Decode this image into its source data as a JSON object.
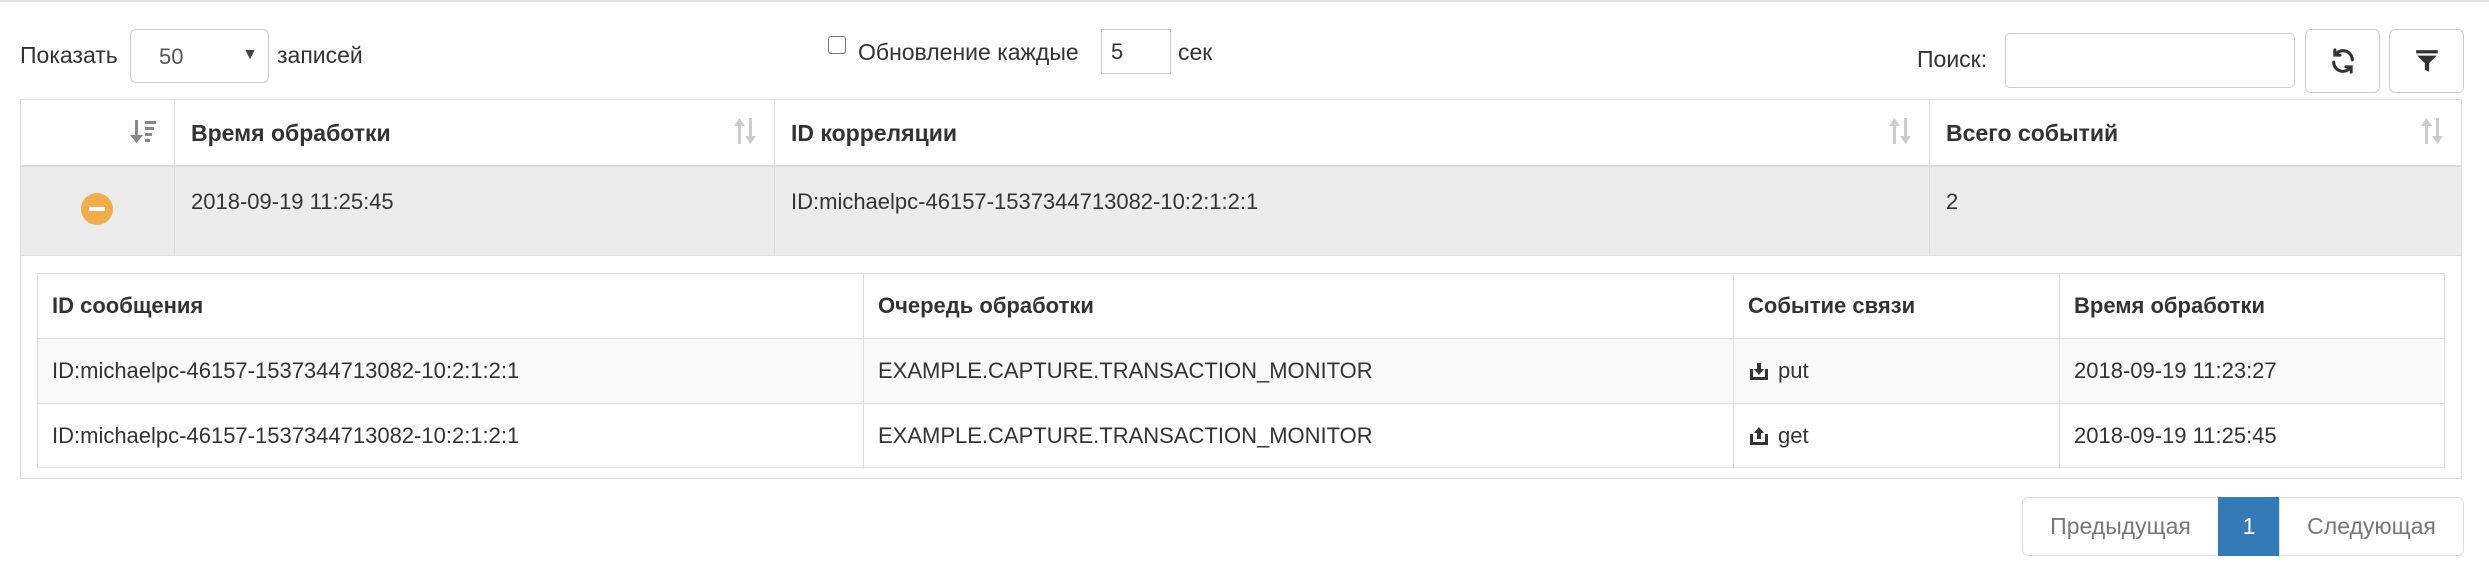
{
  "toolbar": {
    "show_label": "Показать",
    "page_size": "50",
    "records_label": "записей",
    "refresh_label": "Обновление каждые",
    "refresh_interval": "5",
    "seconds_label": "сек",
    "search_label": "Поиск:",
    "search_value": ""
  },
  "table": {
    "columns": [
      "",
      "Время обработки",
      "ID корреляции",
      "Всего событий"
    ],
    "rows": [
      {
        "time": "2018-09-19 11:25:45",
        "correlation_id": "ID:michaelpc-46157-1537344713082-10:2:1:2:1",
        "total": "2"
      }
    ]
  },
  "details": {
    "columns": [
      "ID сообщения",
      "Очередь обработки",
      "Событие связи",
      "Время обработки"
    ],
    "rows": [
      {
        "message_id": "ID:michaelpc-46157-1537344713082-10:2:1:2:1",
        "queue": "EXAMPLE.CAPTURE.TRANSACTION_MONITOR",
        "event": "put",
        "time": "2018-09-19 11:23:27"
      },
      {
        "message_id": "ID:michaelpc-46157-1537344713082-10:2:1:2:1",
        "queue": "EXAMPLE.CAPTURE.TRANSACTION_MONITOR",
        "event": "get",
        "time": "2018-09-19 11:25:45"
      }
    ]
  },
  "pagination": {
    "prev": "Предыдущая",
    "current": "1",
    "next": "Следующая"
  },
  "colors": {
    "accent": "#337ab7",
    "collapse_icon": "#f0ad4e",
    "expanded_row": "#ececec"
  }
}
